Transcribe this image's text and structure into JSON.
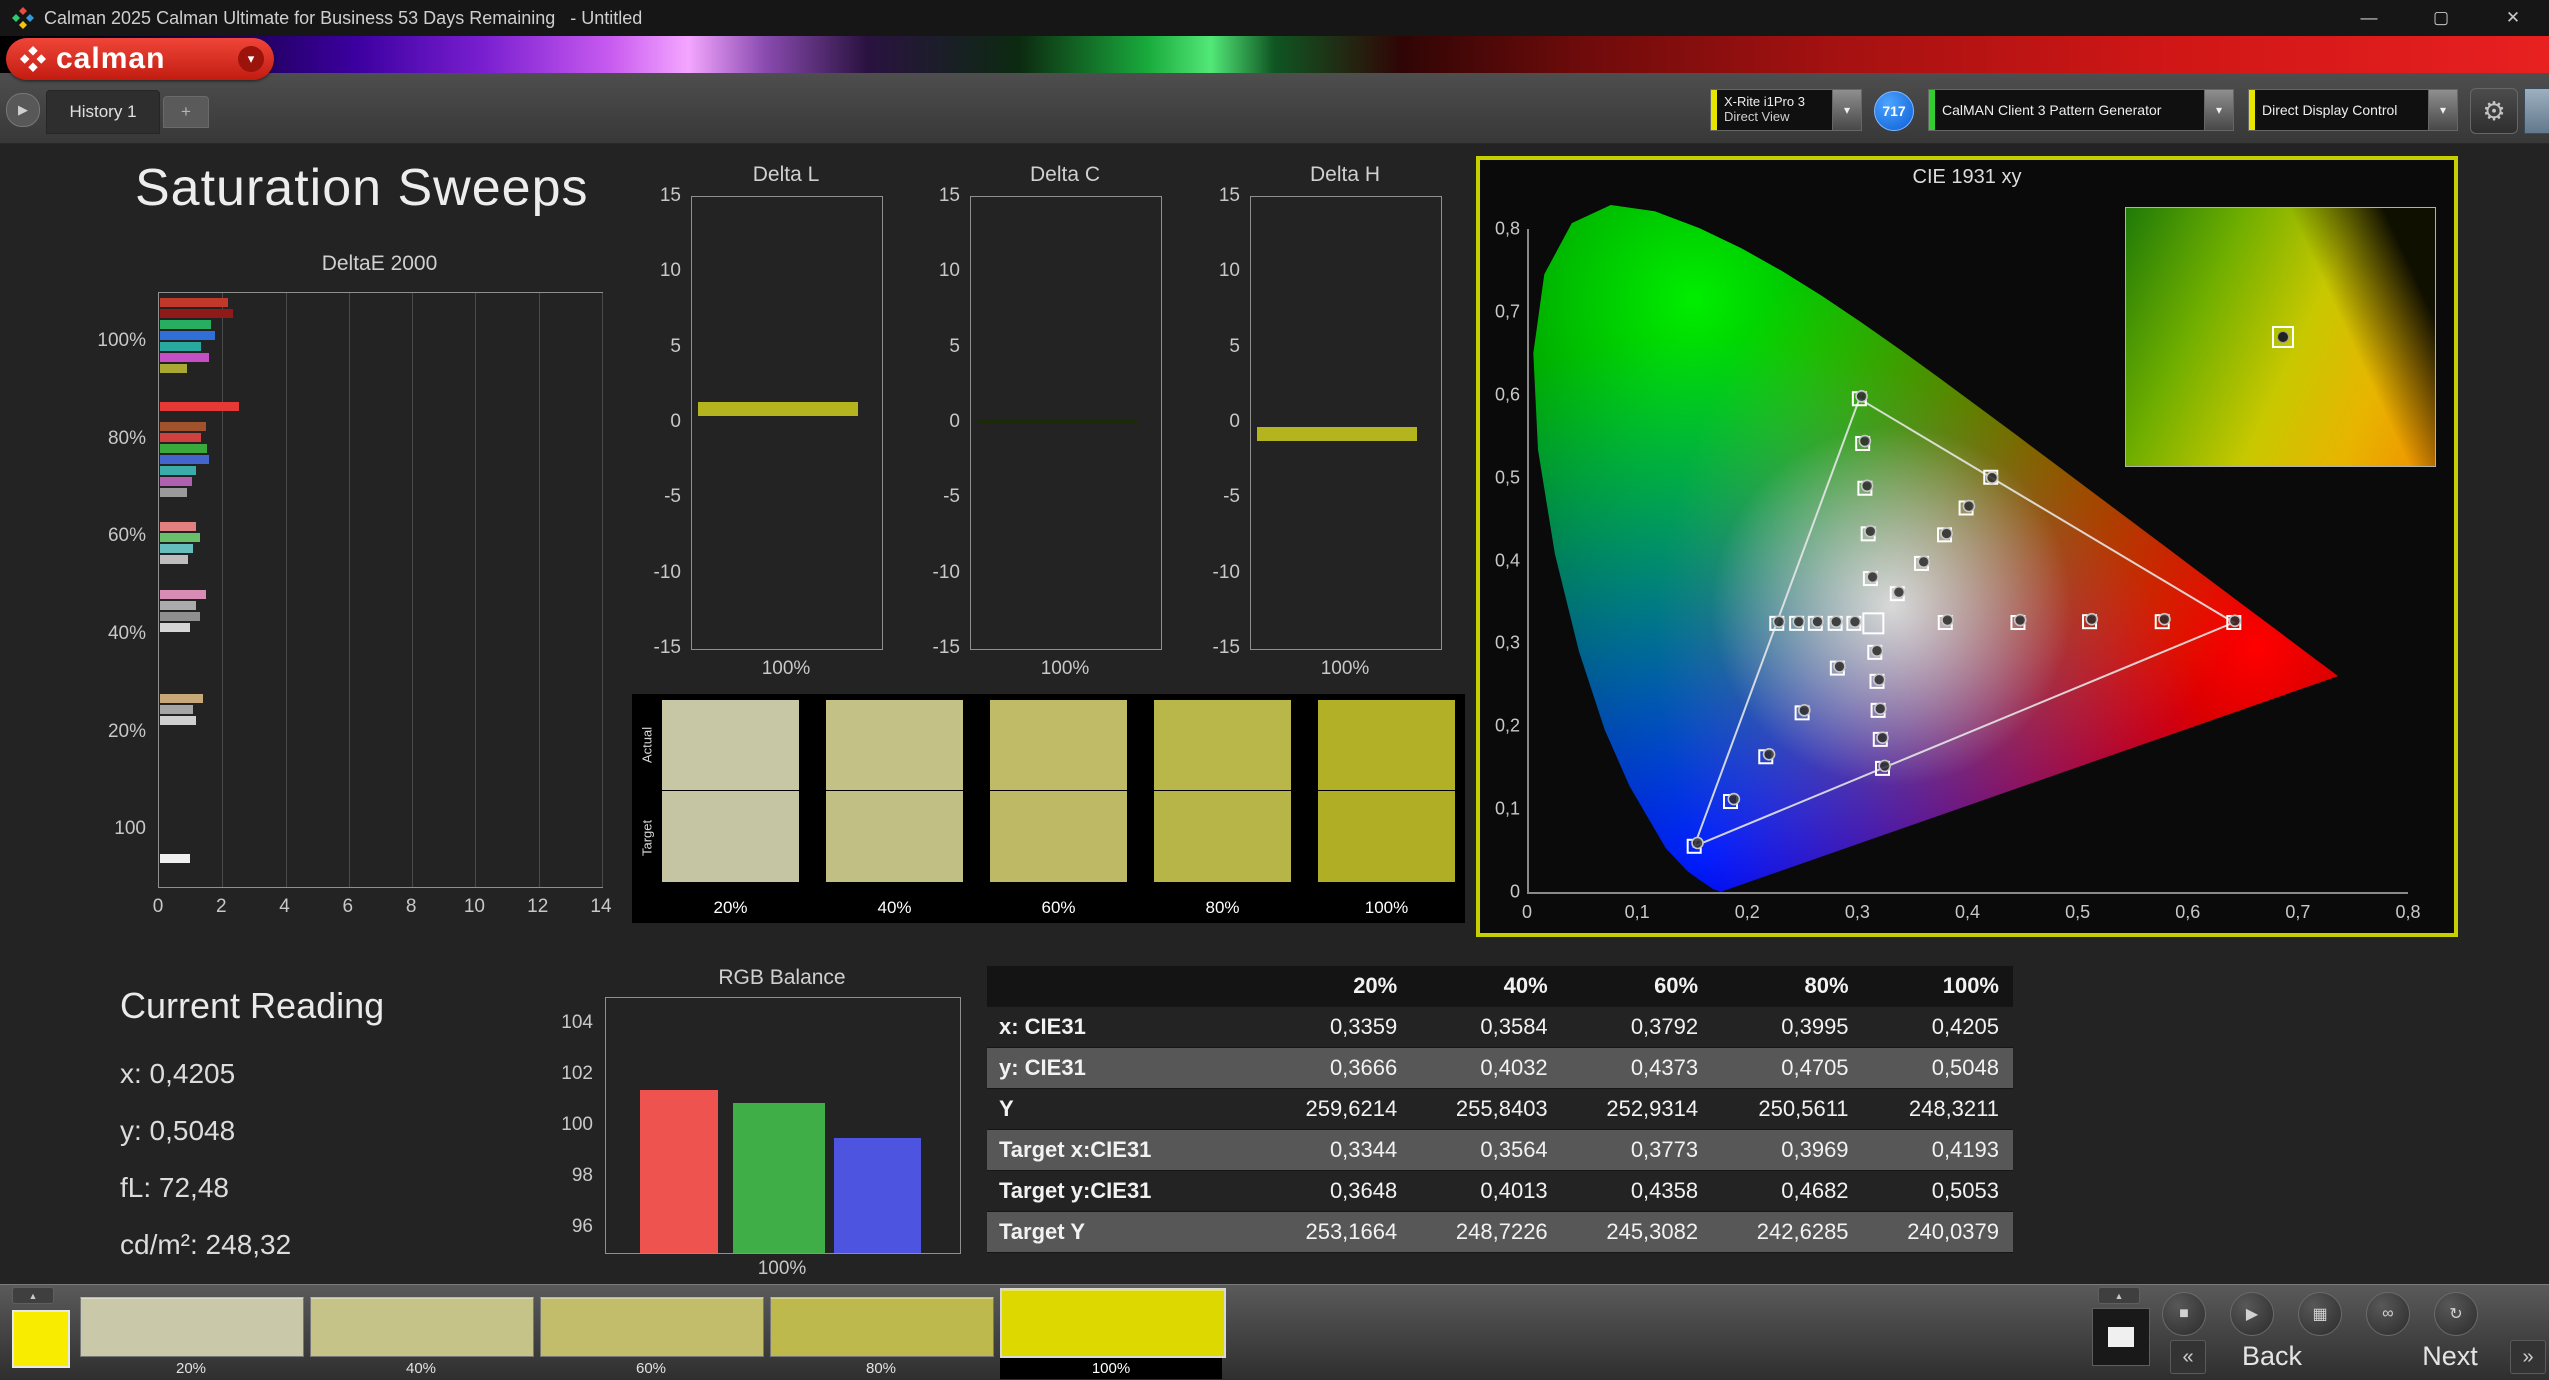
{
  "window": {
    "title": "Calman 2025 Calman Ultimate for Business 53 Days Remaining   - Untitled",
    "minimize": "—",
    "maximize": "▢",
    "close": "✕"
  },
  "logo": {
    "text": "calman",
    "caret": "▾"
  },
  "tab_bar": {
    "history_tab": "History 1",
    "add_tab": "+"
  },
  "device_bar": {
    "meter_line1": "X-Rite i1Pro 3",
    "meter_line2": "Direct View",
    "meter_badge": "717",
    "pattern_generator": "CalMAN Client 3 Pattern Generator",
    "display_control": "Direct Display Control",
    "accent_meter": "#e6e600",
    "accent_pattern": "#33cc33",
    "accent_display": "#e6e600",
    "arrow": "▾",
    "gear": "⚙"
  },
  "page": {
    "title": "Saturation Sweeps"
  },
  "current_reading": {
    "title": "Current Reading",
    "lines": [
      "x: 0,4205",
      "y: 0,5048",
      "fL: 72,48",
      "cd/m²: 248,32"
    ]
  },
  "bottom_bar": {
    "current_patch_color": "#f8ec00",
    "swatches": [
      {
        "label": "20%",
        "color": "#c9c9aa",
        "selected": false
      },
      {
        "label": "40%",
        "color": "#c6c389",
        "selected": false
      },
      {
        "label": "60%",
        "color": "#c1bd6a",
        "selected": false
      },
      {
        "label": "80%",
        "color": "#bdb94c",
        "selected": false
      },
      {
        "label": "100%",
        "color": "#dcd800",
        "selected": true
      }
    ],
    "back_label": "Back",
    "next_label": "Next",
    "prev_icon": "«",
    "next_icon": "»",
    "stop_icon": "■",
    "play_icon": "▶",
    "save_icon": "▦",
    "link_icon": "∞",
    "refresh_icon": "↻",
    "eject_icon": "▲"
  },
  "chart_data": [
    {
      "name": "deltae2000",
      "type": "bar",
      "orientation": "horizontal",
      "title": "DeltaE 2000",
      "xlim": [
        0,
        14
      ],
      "x_ticks": [
        0,
        2,
        4,
        6,
        8,
        10,
        12,
        14
      ],
      "y_axis_labels": [
        {
          "text": "100%",
          "frac": 0.082
        },
        {
          "text": "80%",
          "frac": 0.247
        },
        {
          "text": "60%",
          "frac": 0.411
        },
        {
          "text": "40%",
          "frac": 0.575
        },
        {
          "text": "20%",
          "frac": 0.74
        },
        {
          "text": "100",
          "frac": 0.904
        }
      ],
      "groups": [
        {
          "frac": 0.008,
          "bars": [
            {
              "color": "#c0392b",
              "value": 2.15
            },
            {
              "color": "#8e1a1a",
              "value": 2.3
            },
            {
              "color": "#27ae60",
              "value": 1.6
            },
            {
              "color": "#2e6fd8",
              "value": 1.75
            },
            {
              "color": "#29a8a0",
              "value": 1.3
            },
            {
              "color": "#c44fc4",
              "value": 1.55
            },
            {
              "color": "#a8a832",
              "value": 0.85
            }
          ]
        },
        {
          "frac": 0.184,
          "bars": [
            {
              "color": "#e53935",
              "value": 2.5
            }
          ]
        },
        {
          "frac": 0.218,
          "bars": [
            {
              "color": "#a0522d",
              "value": 1.45
            },
            {
              "color": "#d04040",
              "value": 1.3
            },
            {
              "color": "#3aa83a",
              "value": 1.5
            },
            {
              "color": "#4466cc",
              "value": 1.55
            },
            {
              "color": "#3aabab",
              "value": 1.15
            },
            {
              "color": "#b060b0",
              "value": 1.0
            },
            {
              "color": "#9a9a9a",
              "value": 0.85
            }
          ]
        },
        {
          "frac": 0.385,
          "bars": [
            {
              "color": "#e08080",
              "value": 1.15
            },
            {
              "color": "#6abf6a",
              "value": 1.25
            },
            {
              "color": "#66bdbd",
              "value": 1.05
            },
            {
              "color": "#bdbdbd",
              "value": 0.9
            }
          ]
        },
        {
          "frac": 0.5,
          "bars": [
            {
              "color": "#d98cb3",
              "value": 1.45
            },
            {
              "color": "#ababab",
              "value": 1.15
            },
            {
              "color": "#8f8f8f",
              "value": 1.25
            },
            {
              "color": "#d6d6d6",
              "value": 0.95
            }
          ]
        },
        {
          "frac": 0.675,
          "bars": [
            {
              "color": "#c8a878",
              "value": 1.35
            },
            {
              "color": "#a5a5a5",
              "value": 1.05
            },
            {
              "color": "#cfcfcf",
              "value": 1.15
            }
          ]
        },
        {
          "frac": 0.945,
          "bars": [
            {
              "color": "#f0f0f0",
              "value": 0.95
            }
          ]
        }
      ]
    },
    {
      "name": "delta_l",
      "type": "bar",
      "title": "Delta L",
      "ylim": [
        -15,
        15
      ],
      "y_ticks": [
        15,
        10,
        5,
        0,
        -5,
        -10,
        -15
      ],
      "xlabel": "100%",
      "value": 0.9,
      "bar_color": "#b4b41e",
      "bar_thickness": 14
    },
    {
      "name": "delta_c",
      "type": "bar",
      "title": "Delta C",
      "ylim": [
        -15,
        15
      ],
      "y_ticks": [
        15,
        10,
        5,
        0,
        -5,
        -10,
        -15
      ],
      "xlabel": "100%",
      "value": 0.1,
      "bar_color": "#1d2a08",
      "bar_thickness": 5
    },
    {
      "name": "delta_h",
      "type": "bar",
      "title": "Delta H",
      "ylim": [
        -15,
        15
      ],
      "y_ticks": [
        15,
        10,
        5,
        0,
        -5,
        -10,
        -15
      ],
      "xlabel": "100%",
      "value": -0.7,
      "bar_color": "#b4b41e",
      "bar_thickness": 14
    },
    {
      "name": "saturation_swatches",
      "type": "table",
      "row_labels": [
        "Actual",
        "Target"
      ],
      "columns": [
        "20%",
        "40%",
        "60%",
        "80%",
        "100%"
      ],
      "actual_colors": [
        "#c7c7a5",
        "#c4c186",
        "#bfbb67",
        "#bab74a",
        "#b2b026"
      ],
      "target_colors": [
        "#c5c5a3",
        "#c2bf84",
        "#bdb965",
        "#b8b548",
        "#b0ae24"
      ]
    },
    {
      "name": "cie1931",
      "type": "scatter",
      "title": "CIE 1931 xy",
      "xlim": [
        0,
        0.8
      ],
      "ylim": [
        0,
        0.8
      ],
      "x_tick_labels": [
        "0",
        "0,1",
        "0,2",
        "0,3",
        "0,4",
        "0,5",
        "0,6",
        "0,7",
        "0,8"
      ],
      "y_tick_labels": [
        "0,8",
        "0,7",
        "0,6",
        "0,5",
        "0,4",
        "0,3",
        "0,2",
        "0,1",
        "0"
      ],
      "locus": [
        [
          0.1741,
          0.005
        ],
        [
          0.1669,
          0.0086
        ],
        [
          0.1566,
          0.0177
        ],
        [
          0.144,
          0.0297
        ],
        [
          0.1241,
          0.0578
        ],
        [
          0.0913,
          0.1327
        ],
        [
          0.0687,
          0.2007
        ],
        [
          0.0454,
          0.295
        ],
        [
          0.0235,
          0.4127
        ],
        [
          0.0082,
          0.5384
        ],
        [
          0.0039,
          0.6548
        ],
        [
          0.0139,
          0.7502
        ],
        [
          0.0389,
          0.812
        ],
        [
          0.0743,
          0.8338
        ],
        [
          0.1142,
          0.8262
        ],
        [
          0.1547,
          0.8059
        ],
        [
          0.1929,
          0.7816
        ],
        [
          0.2296,
          0.7543
        ],
        [
          0.2658,
          0.7243
        ],
        [
          0.3016,
          0.6923
        ],
        [
          0.3373,
          0.6589
        ],
        [
          0.3731,
          0.6245
        ],
        [
          0.4087,
          0.5896
        ],
        [
          0.4441,
          0.5547
        ],
        [
          0.4788,
          0.5202
        ],
        [
          0.5125,
          0.4866
        ],
        [
          0.5448,
          0.4544
        ],
        [
          0.5752,
          0.4242
        ],
        [
          0.6029,
          0.3965
        ],
        [
          0.627,
          0.3725
        ],
        [
          0.6482,
          0.3514
        ],
        [
          0.6658,
          0.334
        ],
        [
          0.6801,
          0.3197
        ],
        [
          0.6915,
          0.3083
        ],
        [
          0.7006,
          0.2993
        ],
        [
          0.714,
          0.2859
        ],
        [
          0.726,
          0.274
        ],
        [
          0.7347,
          0.2653
        ]
      ],
      "gamut_triangle": [
        [
          0.64,
          0.33
        ],
        [
          0.3,
          0.6
        ],
        [
          0.15,
          0.06
        ]
      ],
      "white_point": [
        0.3127,
        0.329
      ],
      "sweeps": [
        {
          "name": "yellow",
          "targets": [
            [
              0.3344,
              0.3648
            ],
            [
              0.3564,
              0.4013
            ],
            [
              0.3773,
              0.4358
            ],
            [
              0.3969,
              0.4682
            ],
            [
              0.4193,
              0.5053
            ]
          ],
          "measured": [
            [
              0.3359,
              0.3666
            ],
            [
              0.3584,
              0.4032
            ],
            [
              0.3792,
              0.4373
            ],
            [
              0.3995,
              0.4705
            ],
            [
              0.4205,
              0.5048
            ]
          ]
        },
        {
          "name": "red",
          "targets": [
            [
              0.378,
              0.33
            ],
            [
              0.444,
              0.33
            ],
            [
              0.509,
              0.331
            ],
            [
              0.575,
              0.331
            ],
            [
              0.64,
              0.33
            ]
          ],
          "measured": [
            [
              0.38,
              0.333
            ],
            [
              0.446,
              0.333
            ],
            [
              0.511,
              0.334
            ],
            [
              0.577,
              0.334
            ],
            [
              0.641,
              0.332
            ]
          ]
        },
        {
          "name": "green",
          "targets": [
            [
              0.31,
              0.383
            ],
            [
              0.308,
              0.437
            ],
            [
              0.305,
              0.492
            ],
            [
              0.303,
              0.546
            ],
            [
              0.3,
              0.6
            ]
          ],
          "measured": [
            [
              0.312,
              0.385
            ],
            [
              0.31,
              0.44
            ],
            [
              0.307,
              0.495
            ],
            [
              0.305,
              0.549
            ],
            [
              0.302,
              0.603
            ]
          ]
        },
        {
          "name": "blue",
          "targets": [
            [
              0.28,
              0.275
            ],
            [
              0.248,
              0.221
            ],
            [
              0.215,
              0.168
            ],
            [
              0.183,
              0.114
            ],
            [
              0.15,
              0.06
            ]
          ],
          "measured": [
            [
              0.282,
              0.277
            ],
            [
              0.25,
              0.224
            ],
            [
              0.218,
              0.171
            ],
            [
              0.186,
              0.117
            ],
            [
              0.153,
              0.064
            ]
          ]
        },
        {
          "name": "cyan",
          "targets": [
            [
              0.295,
              0.329
            ],
            [
              0.278,
              0.329
            ],
            [
              0.26,
              0.329
            ],
            [
              0.243,
              0.329
            ],
            [
              0.225,
              0.329
            ]
          ],
          "measured": [
            [
              0.296,
              0.331
            ],
            [
              0.279,
              0.331
            ],
            [
              0.262,
              0.331
            ],
            [
              0.245,
              0.331
            ],
            [
              0.227,
              0.331
            ]
          ]
        },
        {
          "name": "magenta",
          "targets": [
            [
              0.314,
              0.294
            ],
            [
              0.316,
              0.259
            ],
            [
              0.317,
              0.224
            ],
            [
              0.319,
              0.189
            ],
            [
              0.321,
              0.154
            ]
          ],
          "measured": [
            [
              0.316,
              0.296
            ],
            [
              0.318,
              0.261
            ],
            [
              0.319,
              0.226
            ],
            [
              0.321,
              0.191
            ],
            [
              0.323,
              0.157
            ]
          ]
        }
      ],
      "inset_marker": [
        0.42,
        0.505
      ]
    },
    {
      "name": "rgb_balance",
      "type": "bar",
      "title": "RGB Balance",
      "categories": [
        "Red",
        "Green",
        "Blue"
      ],
      "values": [
        101.4,
        100.9,
        99.5
      ],
      "colors": [
        "#ef5350",
        "#3fae46",
        "#4d55e0"
      ],
      "ylim": [
        95,
        105
      ],
      "y_ticks": [
        104,
        102,
        100,
        98,
        96
      ],
      "xlabel": "100%"
    },
    {
      "name": "results_table",
      "type": "table",
      "columns": [
        "20%",
        "40%",
        "60%",
        "80%",
        "100%"
      ],
      "rows": [
        {
          "label": "x: CIE31",
          "values": [
            "0,3359",
            "0,3584",
            "0,3792",
            "0,3995",
            "0,4205"
          ]
        },
        {
          "label": "y: CIE31",
          "values": [
            "0,3666",
            "0,4032",
            "0,4373",
            "0,4705",
            "0,5048"
          ]
        },
        {
          "label": "Y",
          "values": [
            "259,6214",
            "255,8403",
            "252,9314",
            "250,5611",
            "248,3211"
          ]
        },
        {
          "label": "Target x:CIE31",
          "values": [
            "0,3344",
            "0,3564",
            "0,3773",
            "0,3969",
            "0,4193"
          ]
        },
        {
          "label": "Target y:CIE31",
          "values": [
            "0,3648",
            "0,4013",
            "0,4358",
            "0,4682",
            "0,5053"
          ]
        },
        {
          "label": "Target Y",
          "values": [
            "253,1664",
            "248,7226",
            "245,3082",
            "242,6285",
            "240,0379"
          ]
        }
      ]
    }
  ]
}
